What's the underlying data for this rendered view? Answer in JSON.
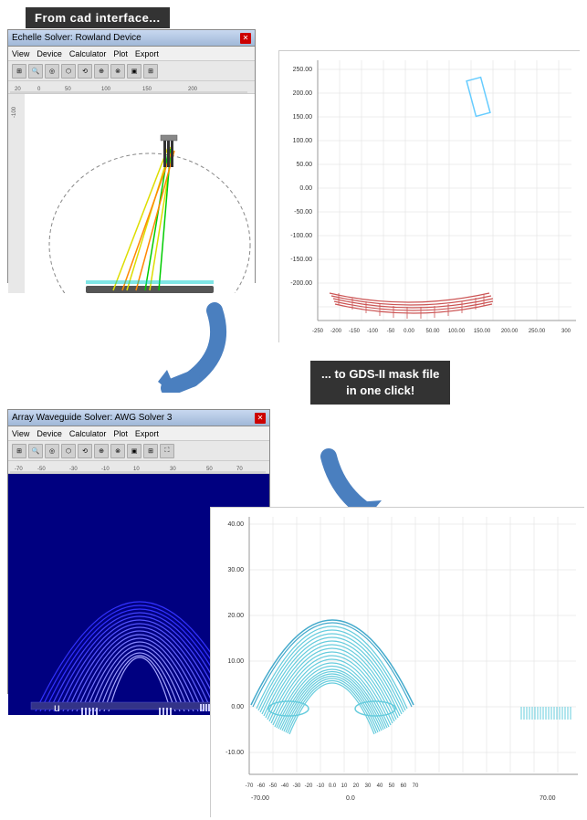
{
  "top_label": "From cad interface...",
  "gds_label": "... to GDS-II mask file\n    in one click!",
  "gds_line1": "... to GDS-II mask file",
  "gds_line2": "in one click!",
  "to_text": "to",
  "cad_window": {
    "title": "Echelle Solver: Rowland Device",
    "menu_items": [
      "View",
      "Device",
      "Calculator",
      "Plot",
      "Export"
    ]
  },
  "awg_window": {
    "title": "Array Waveguide Solver: AWG Solver 3",
    "menu_items": [
      "View",
      "Device",
      "Calculator",
      "Plot",
      "Export"
    ]
  },
  "top_right_yaxis": [
    "250.00",
    "200.00",
    "150.00",
    "100.00",
    "50.00",
    "0.00",
    "-50.00",
    "-100.00",
    "-150.00",
    "-200.00"
  ],
  "top_right_xaxis": [
    "-250.00",
    "-200.00",
    "-150.00",
    "-100.00",
    "-50.00",
    "0.00",
    "50.00",
    "100.00",
    "150.00",
    "200.00",
    "250.00",
    "300"
  ],
  "bottom_right_yaxis": [
    "40.00",
    "30.00",
    "20.00",
    "10.00",
    "0.00",
    "-10.00"
  ],
  "bottom_right_xaxis": [
    "-70.00",
    "-60.00",
    "-50.00",
    "-40.00",
    "-30.00",
    "-20.00",
    "-10.00",
    "0.0",
    "10.00",
    "20.00",
    "30.00",
    "40.00",
    "50.00",
    "60.00",
    "70.00"
  ]
}
